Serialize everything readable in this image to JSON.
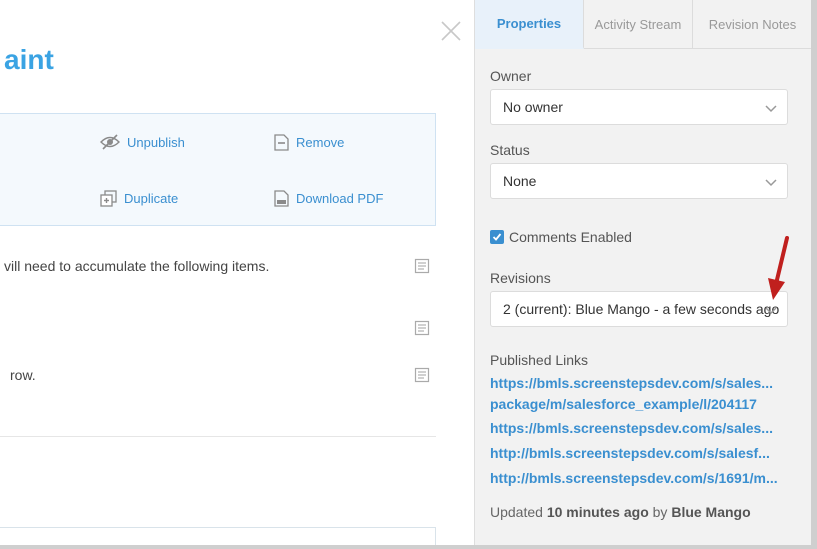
{
  "editor": {
    "title": "aint",
    "actions": {
      "unpublish": "Unpublish",
      "remove": "Remove",
      "duplicate": "Duplicate",
      "download_pdf": "Download PDF"
    },
    "body": [
      "vill need to accumulate the following items.",
      "row."
    ]
  },
  "panel": {
    "tabs": [
      "Properties",
      "Activity Stream",
      "Revision Notes"
    ],
    "active_tab": "Properties",
    "owner": {
      "label": "Owner",
      "value": "No owner"
    },
    "status": {
      "label": "Status",
      "value": "None"
    },
    "comments": {
      "label": "Comments Enabled",
      "checked": true
    },
    "revisions": {
      "label": "Revisions",
      "value": "2 (current): Blue Mango - a few seconds ago"
    },
    "published_links": {
      "label": "Published Links",
      "links": [
        "https://bmls.screenstepsdev.com/s/sales...",
        "package/m/salesforce_example/l/204117",
        "https://bmls.screenstepsdev.com/s/sales...",
        "http://bmls.screenstepsdev.com/s/salesf...",
        "http://bmls.screenstepsdev.com/s/1691/m..."
      ]
    },
    "updated": {
      "prefix": "Updated",
      "time": "10 minutes ago",
      "by": "by",
      "user": "Blue Mango"
    }
  },
  "colors": {
    "accent": "#3a8fd0",
    "title": "#3aa3e3",
    "arrow": "#c0201e",
    "panel_bg": "#f2f2f2"
  }
}
